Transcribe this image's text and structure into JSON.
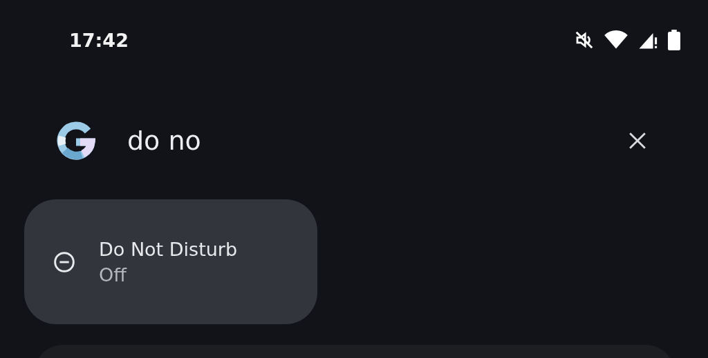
{
  "status_bar": {
    "time": "17:42"
  },
  "search": {
    "value": "do no"
  },
  "results": [
    {
      "title": "Do Not Disturb",
      "subtitle": "Off"
    }
  ]
}
